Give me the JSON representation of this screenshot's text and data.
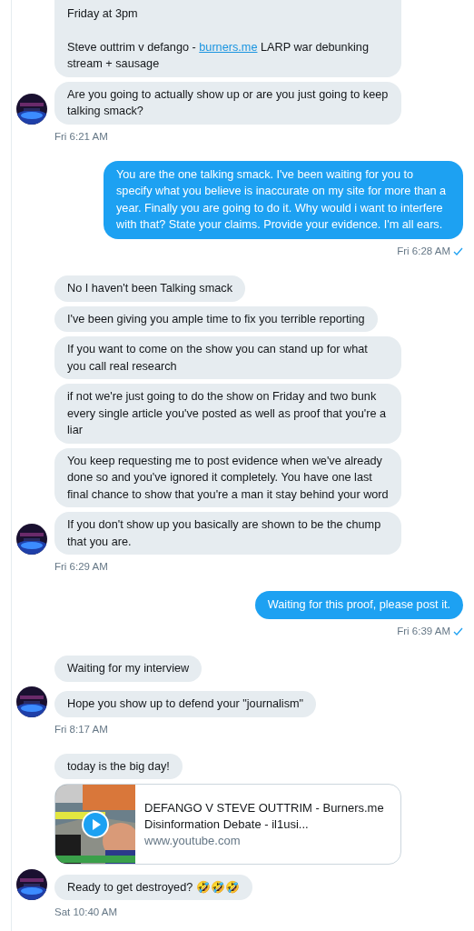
{
  "groups": [
    {
      "kind": "received",
      "messages": [
        {
          "kind": "text",
          "paragraphs": [
            {
              "text": "Friday at 3pm"
            },
            {
              "text": "Steve outtrim v defango - ",
              "link": "burners.me",
              "after": " LARP war debunking stream + sausage"
            }
          ]
        },
        {
          "kind": "text",
          "paragraphs": [
            {
              "text": "Are you going to actually show up or are you just going to keep talking smack?"
            }
          ]
        }
      ],
      "time": "Fri 6:21 AM"
    },
    {
      "kind": "sent",
      "seen": true,
      "messages": [
        {
          "kind": "text",
          "paragraphs": [
            {
              "text": "You are the one talking smack. I've been waiting for you to specify what you believe is inaccurate on my site for more than a year. Finally you are going to do it. Why would i want to interfere with that? State your claims. Provide your evidence. I'm all ears."
            }
          ]
        }
      ],
      "time": "Fri 6:28 AM"
    },
    {
      "kind": "received",
      "messages": [
        {
          "kind": "text",
          "paragraphs": [
            {
              "text": "No I haven't been Talking smack"
            }
          ]
        },
        {
          "kind": "text",
          "paragraphs": [
            {
              "text": "I've been giving you ample time to fix you terrible reporting"
            }
          ]
        },
        {
          "kind": "text",
          "paragraphs": [
            {
              "text": "If you want to come on the show you can stand up for what you call real research"
            }
          ]
        },
        {
          "kind": "text",
          "paragraphs": [
            {
              "text": "if not we're just going to do the show on Friday and two bunk every single article you've posted as well as proof that you're a liar"
            }
          ]
        },
        {
          "kind": "text",
          "paragraphs": [
            {
              "text": "You keep requesting me to post evidence when we've already done so and you've ignored it completely. You have one last final chance to show that you're a man it stay behind your word"
            }
          ]
        },
        {
          "kind": "text",
          "paragraphs": [
            {
              "text": "If you don't show up you basically are shown to be the chump that you are."
            }
          ]
        }
      ],
      "time": "Fri 6:29 AM"
    },
    {
      "kind": "sent",
      "seen": true,
      "messages": [
        {
          "kind": "text",
          "paragraphs": [
            {
              "text": "Waiting for this proof, please post it."
            }
          ]
        }
      ],
      "time": "Fri 6:39 AM"
    },
    {
      "kind": "received",
      "messages": [
        {
          "kind": "text",
          "paragraphs": [
            {
              "text": "Waiting for my interview"
            }
          ]
        },
        {
          "kind": "text",
          "paragraphs": [
            {
              "text": "Hope you show up to defend your \"journalism\""
            }
          ]
        }
      ],
      "time": "Fri 8:17 AM"
    },
    {
      "kind": "received",
      "messages": [
        {
          "kind": "text",
          "paragraphs": [
            {
              "text": "today is the big day!"
            }
          ]
        },
        {
          "kind": "video_card",
          "title": "DEFANGO V STEVE OUTTRIM - Burners.me Disinformation Debate - il1usi...",
          "domain": "www.youtube.com"
        },
        {
          "kind": "text",
          "paragraphs": [
            {
              "text": "Ready to get destroyed? 🤣🤣🤣"
            }
          ]
        }
      ],
      "time": "Sat 10:40 AM"
    }
  ]
}
